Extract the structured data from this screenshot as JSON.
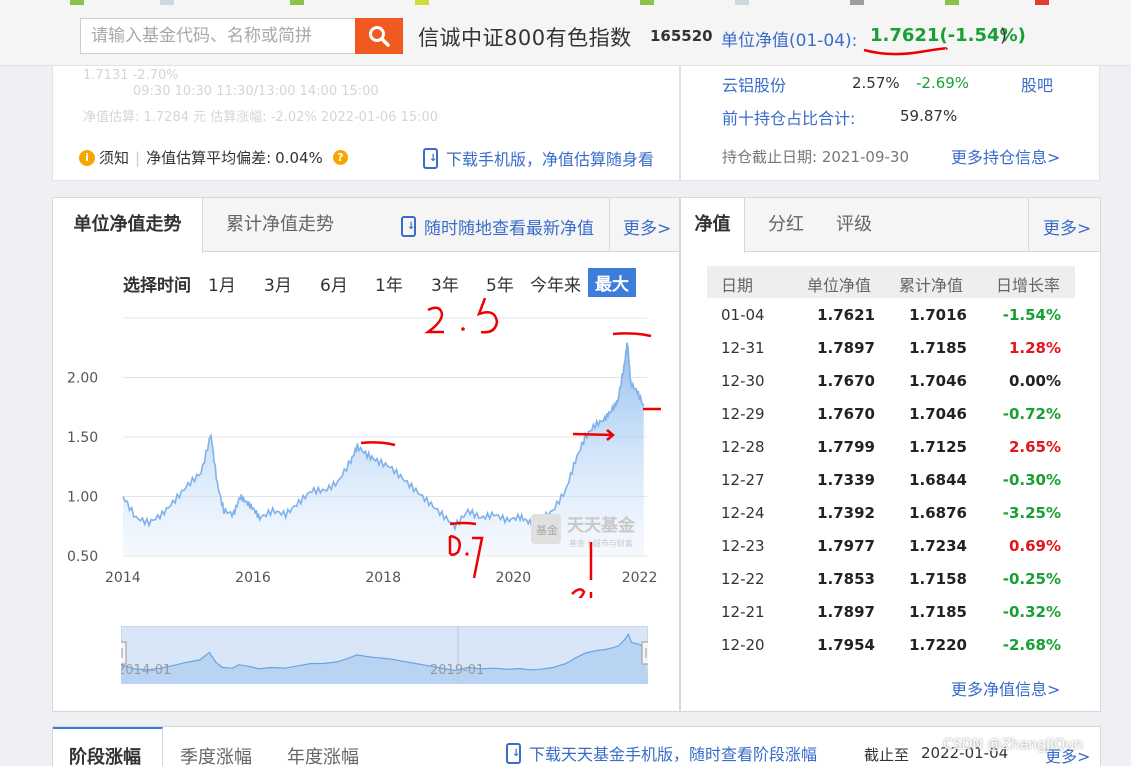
{
  "colors": {
    "accent_orange": "#f05a21",
    "link_blue": "#3a6cc9",
    "up_red": "#e4141b",
    "down_green": "#18a033",
    "active_time_bg": "#3d7ddb"
  },
  "header": {
    "search_placeholder": "请输入基金代码、名称或简拼",
    "fund_name": "信诚中证800有色指数",
    "fund_code": "165520",
    "nav_label": "单位净值(01-04):",
    "nav_value": "1.7621(-1.54%)",
    "nav_close": ")"
  },
  "estimate": {
    "faded_line1": "1.7131                      -2.70%",
    "faded_axis": "09:30      10:30      11:30/13:00      14:00      15:00",
    "faded_line2": "净值估算: 1.7284 元  估算涨幅: -2.02% 2022-01-06 15:00",
    "notice_label": "须知",
    "deviation_label": "净值估算平均偏差:",
    "deviation_value": "0.04%",
    "download_text": "下载手机版，净值估算随身看"
  },
  "holdings": {
    "stock_name": "云铝股份",
    "stock_weight": "2.57%",
    "stock_change": "-2.69%",
    "stock_bar": "股吧",
    "top10_label": "前十持仓占比合计:",
    "top10_value": "59.87%",
    "as_of": "持仓截止日期: 2021-09-30",
    "more": "更多持仓信息>"
  },
  "chart_panel": {
    "tab_unit": "单位净值走势",
    "tab_acc": "累计净值走势",
    "mobile_link": "随时随地查看最新净值",
    "more": "更多>",
    "time_ranges": [
      "选择时间",
      "1月",
      "3月",
      "6月",
      "1年",
      "3年",
      "5年",
      "今年来",
      "最大"
    ],
    "watermark_main": "天天基金",
    "watermark_sub": "基金 | 超市与财富"
  },
  "chart_data": {
    "type": "area",
    "title": "",
    "xlabel": "",
    "ylabel": "",
    "ylim": [
      0.5,
      2.5
    ],
    "xlim": [
      2014.0,
      2022.05
    ],
    "yticks": [
      "0.50",
      "1.00",
      "1.50",
      "2.00"
    ],
    "xticks": [
      "2014",
      "2016",
      "2018",
      "2020",
      "2022"
    ],
    "grid": true,
    "series": [
      {
        "x": [
          2014.0,
          2014.2,
          2014.4,
          2014.6,
          2014.8,
          2015.0,
          2015.2,
          2015.35,
          2015.45,
          2015.55,
          2015.7,
          2015.8,
          2015.9,
          2016.0,
          2016.1,
          2016.3,
          2016.5,
          2016.7,
          2016.9,
          2017.1,
          2017.3,
          2017.5,
          2017.6,
          2017.75,
          2017.9,
          2018.1,
          2018.3,
          2018.5,
          2018.7,
          2018.9,
          2019.1,
          2019.3,
          2019.5,
          2019.7,
          2019.9,
          2020.1,
          2020.25,
          2020.4,
          2020.6,
          2020.8,
          2020.95,
          2021.1,
          2021.25,
          2021.4,
          2021.5,
          2021.6,
          2021.7,
          2021.75,
          2021.8,
          2021.9,
          2022.0
        ],
        "y": [
          1.0,
          0.82,
          0.78,
          0.85,
          0.97,
          1.1,
          1.2,
          1.52,
          1.1,
          0.88,
          0.85,
          1.0,
          0.95,
          0.9,
          0.82,
          0.88,
          0.85,
          0.95,
          1.05,
          1.05,
          1.12,
          1.3,
          1.42,
          1.35,
          1.3,
          1.25,
          1.15,
          1.05,
          0.95,
          0.85,
          0.75,
          0.88,
          0.82,
          0.85,
          0.8,
          0.83,
          0.78,
          0.8,
          0.88,
          1.05,
          1.3,
          1.5,
          1.6,
          1.65,
          1.72,
          1.8,
          2.1,
          2.3,
          1.95,
          1.88,
          1.76
        ]
      }
    ],
    "navigator": {
      "labels": [
        "2014-01",
        "2019-01"
      ]
    }
  },
  "annotations": {
    "top_label": "2.5",
    "low_label": "0.7",
    "year_label": "21"
  },
  "nav_table": {
    "tabs": [
      "净值",
      "分红",
      "评级"
    ],
    "more": "更多>",
    "headers": [
      "日期",
      "单位净值",
      "累计净值",
      "日增长率"
    ],
    "rows": [
      [
        "01-04",
        "1.7621",
        "1.7016",
        "-1.54%"
      ],
      [
        "12-31",
        "1.7897",
        "1.7185",
        "1.28%"
      ],
      [
        "12-30",
        "1.7670",
        "1.7046",
        "0.00%"
      ],
      [
        "12-29",
        "1.7670",
        "1.7046",
        "-0.72%"
      ],
      [
        "12-28",
        "1.7799",
        "1.7125",
        "2.65%"
      ],
      [
        "12-27",
        "1.7339",
        "1.6844",
        "-0.30%"
      ],
      [
        "12-24",
        "1.7392",
        "1.6876",
        "-3.25%"
      ],
      [
        "12-23",
        "1.7977",
        "1.7234",
        "0.69%"
      ],
      [
        "12-22",
        "1.7853",
        "1.7158",
        "-0.25%"
      ],
      [
        "12-21",
        "1.7897",
        "1.7185",
        "-0.32%"
      ],
      [
        "12-20",
        "1.7954",
        "1.7220",
        "-2.68%"
      ]
    ],
    "more_info": "更多净值信息>"
  },
  "bottom": {
    "tabs": [
      "阶段涨幅",
      "季度涨幅",
      "年度涨幅"
    ],
    "download_text": "下载天天基金手机版，随时查看阶段涨幅",
    "as_of_label": "截止至",
    "as_of_date": "2022-01-04",
    "more": "更多>",
    "watermark": "CSDN @ZhangJiQun"
  }
}
